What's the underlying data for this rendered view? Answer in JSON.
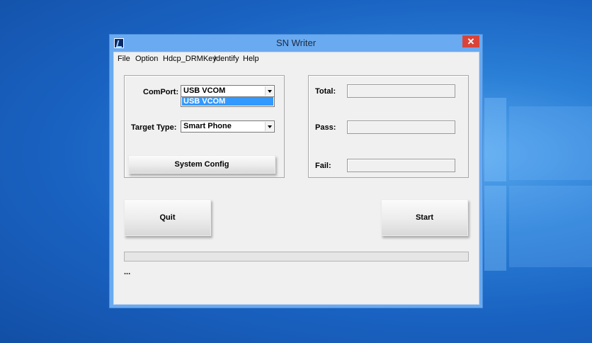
{
  "window": {
    "title": "SN Writer",
    "close_label": "✕"
  },
  "menu": {
    "items": [
      "File",
      "Option",
      "Hdcp_DRMKey",
      "Identify",
      "Help"
    ]
  },
  "settings": {
    "comport_label": "ComPort:",
    "comport_value": "USB VCOM",
    "comport_options": [
      "USB VCOM"
    ],
    "target_type_label": "Target Type:",
    "target_type_value": "Smart Phone",
    "system_config_label": "System Config"
  },
  "stats": {
    "total_label": "Total:",
    "total_value": "",
    "pass_label": "Pass:",
    "pass_value": "",
    "fail_label": "Fail:",
    "fail_value": ""
  },
  "actions": {
    "quit_label": "Quit",
    "start_label": "Start"
  },
  "status": {
    "progress": 0,
    "text": "..."
  },
  "colors": {
    "accent_highlight": "#3399ff",
    "close_button": "#d9443a",
    "window_frame": "#6aaaf0"
  }
}
